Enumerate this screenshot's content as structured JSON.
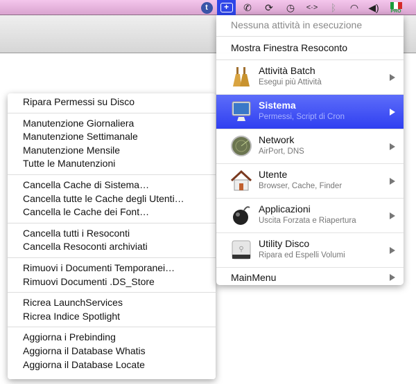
{
  "menubar": {
    "icons": [
      "tumblr-icon",
      "add-icon",
      "phone-icon",
      "sync-icon",
      "time-machine-icon",
      "code-icon",
      "bluetooth-icon",
      "wifi-icon",
      "volume-icon",
      "flag-italy-icon"
    ],
    "flag_badge": "PRO"
  },
  "right_menu": {
    "status": "Nessuna attività in esecuzione",
    "show_report": "Mostra Finestra Resoconto",
    "items": [
      {
        "title": "Attività Batch",
        "subtitle": "Esegui più Attività",
        "icon": "broom-icon"
      },
      {
        "title": "Sistema",
        "subtitle": "Permessi, Script di Cron",
        "icon": "monitor-icon"
      },
      {
        "title": "Network",
        "subtitle": "AirPort, DNS",
        "icon": "radar-icon"
      },
      {
        "title": "Utente",
        "subtitle": "Browser, Cache, Finder",
        "icon": "house-icon"
      },
      {
        "title": "Applicazioni",
        "subtitle": "Uscita Forzata e Riapertura",
        "icon": "bomb-icon"
      },
      {
        "title": "Utility Disco",
        "subtitle": "Ripara ed Espelli Volumi",
        "icon": "disk-icon"
      }
    ],
    "main_menu": "MainMenu",
    "highlight_color": "#3c4cf3"
  },
  "left_menu": {
    "groups": [
      [
        "Ripara Permessi su Disco"
      ],
      [
        "Manutenzione Giornaliera",
        "Manutenzione Settimanale",
        "Manutenzione Mensile",
        "Tutte le Manutenzioni"
      ],
      [
        "Cancella Cache di Sistema…",
        "Cancella tutte le Cache degli Utenti…",
        "Cancella le Cache dei Font…"
      ],
      [
        "Cancella tutti i Resoconti",
        "Cancella Resoconti archiviati"
      ],
      [
        "Rimuovi i Documenti Temporanei…",
        "Rimuovi Documenti .DS_Store"
      ],
      [
        "Ricrea LaunchServices",
        "Ricrea Indice Spotlight"
      ],
      [
        "Aggiorna i Prebinding",
        "Aggiorna il Database Whatis",
        "Aggiorna il Database Locate"
      ]
    ]
  }
}
